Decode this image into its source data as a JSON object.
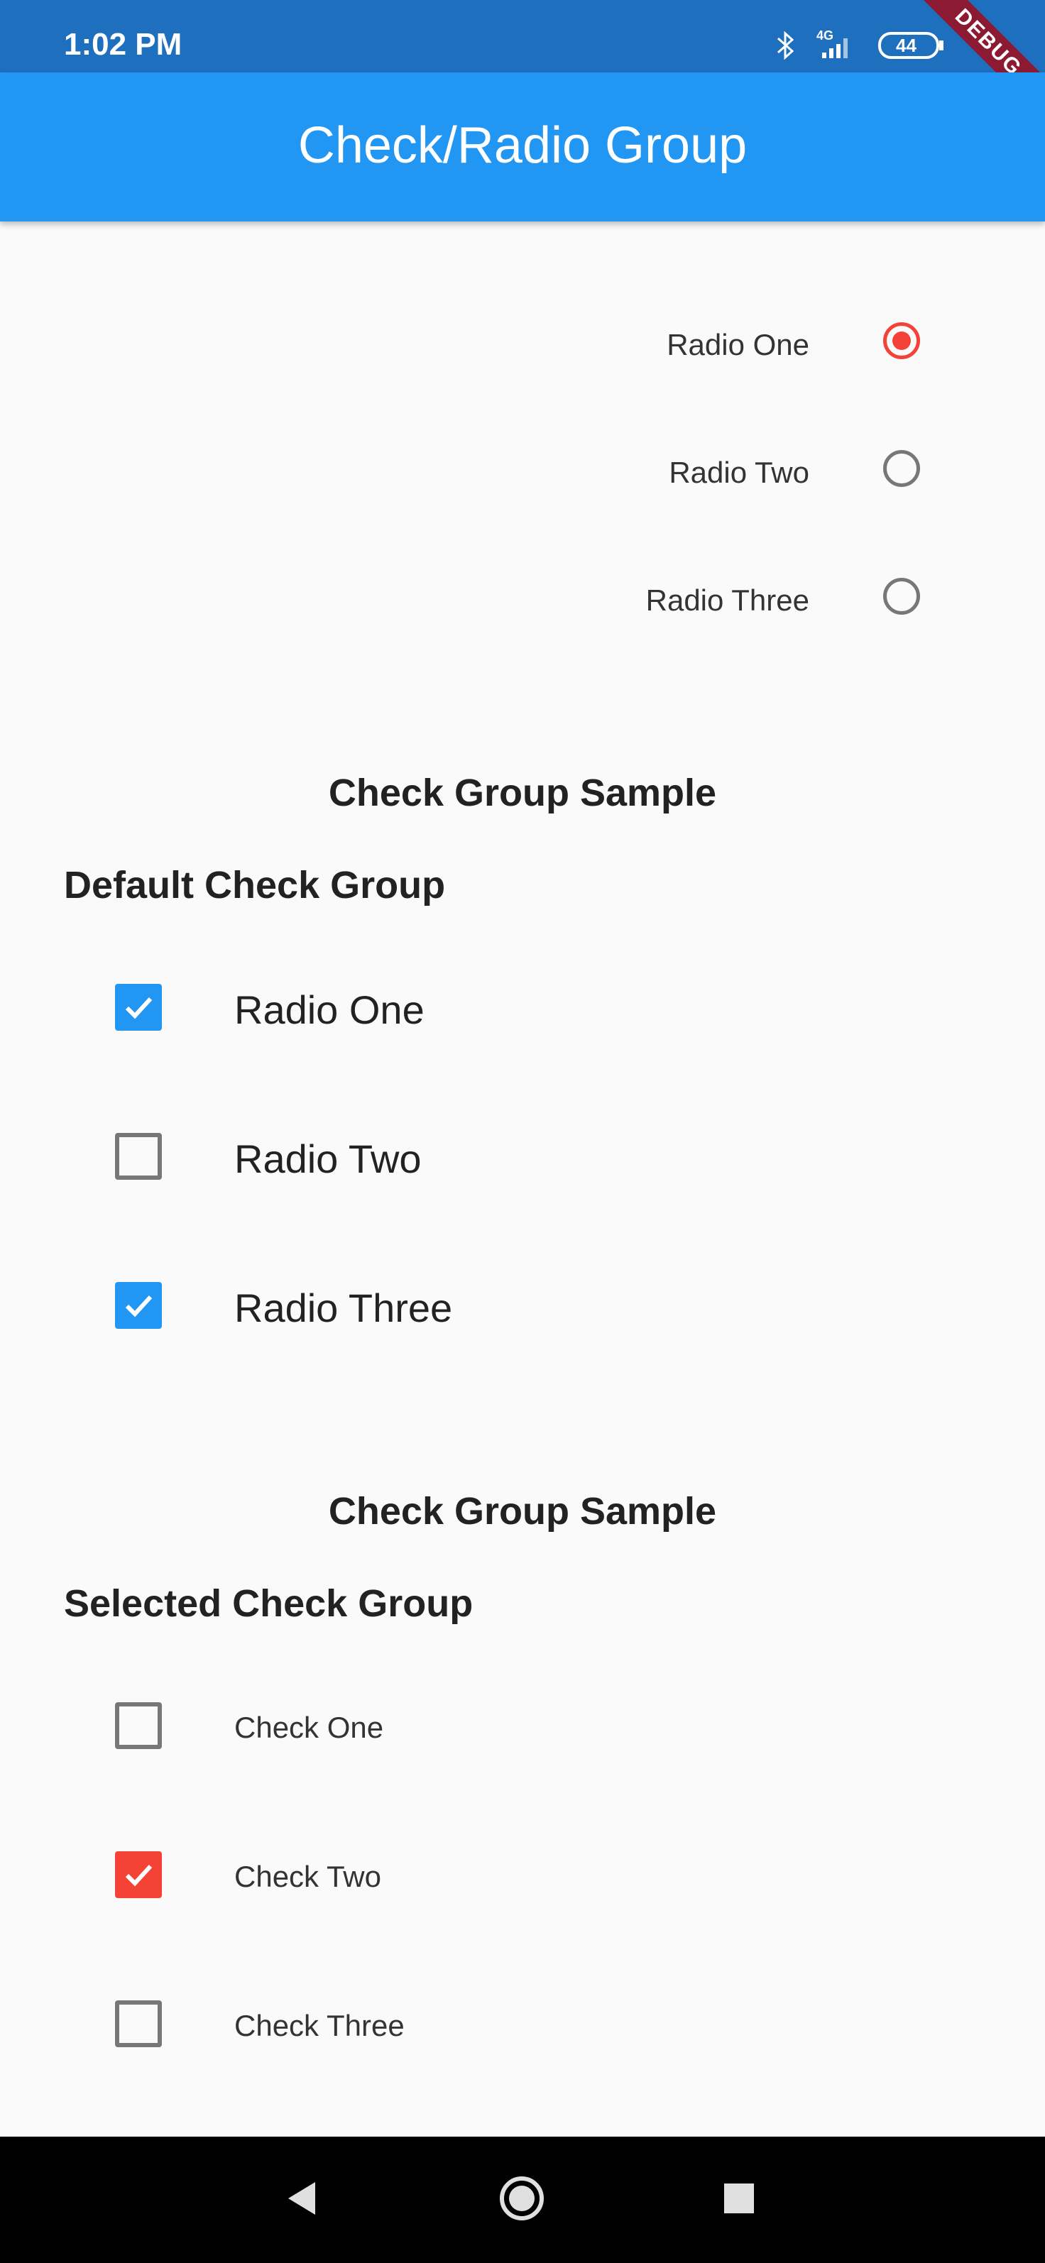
{
  "status_bar": {
    "time": "1:02 PM",
    "network": "4G",
    "battery": "44",
    "debug_banner": "DEBUG"
  },
  "app_bar": {
    "title": "Check/Radio Group"
  },
  "radio_group": {
    "items": [
      {
        "label": "Radio One",
        "selected": true
      },
      {
        "label": "Radio Two",
        "selected": false
      },
      {
        "label": "Radio Three",
        "selected": false
      }
    ],
    "selected_color": "#f44336"
  },
  "default_check_section": {
    "section_title": "Check Group Sample",
    "group_title": "Default Check Group",
    "items": [
      {
        "label": "Radio One",
        "checked": true
      },
      {
        "label": "Radio Two",
        "checked": false
      },
      {
        "label": "Radio Three",
        "checked": true
      }
    ],
    "checked_color": "#2196f3"
  },
  "selected_check_section": {
    "section_title": "Check Group Sample",
    "group_title": "Selected Check Group",
    "items": [
      {
        "label": "Check One",
        "checked": false
      },
      {
        "label": "Check Two",
        "checked": true
      },
      {
        "label": "Check Three",
        "checked": false
      }
    ],
    "checked_color": "#f44336"
  },
  "colors": {
    "app_bar": "#2196f3",
    "status_bar": "#1f6fbf",
    "accent_red": "#f44336",
    "accent_blue": "#2196f3"
  }
}
